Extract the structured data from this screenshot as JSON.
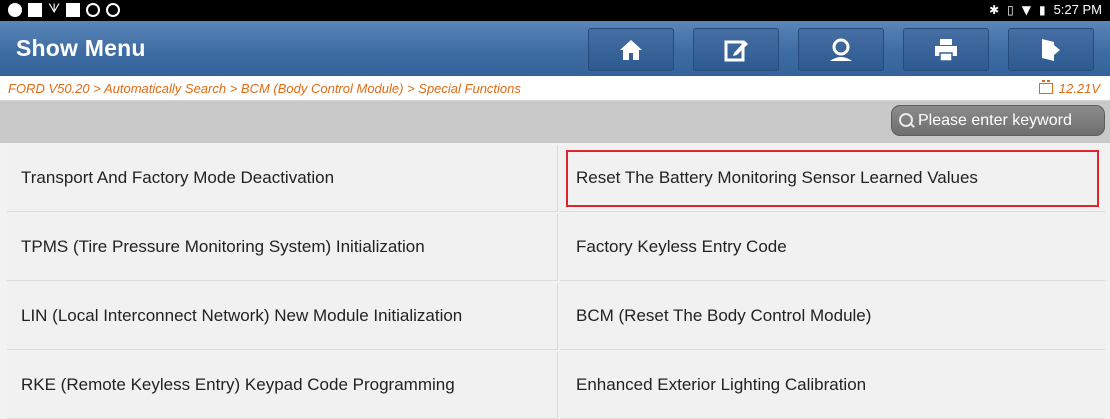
{
  "status_bar": {
    "left_icons": [
      "app-icon",
      "image-icon",
      "usb-icon",
      "square-icon",
      "record-icon",
      "camera-icon"
    ],
    "right_icons": [
      "bluetooth-icon",
      "vibrate-icon",
      "wifi-icon",
      "battery-icon"
    ],
    "time": "5:27 PM"
  },
  "header": {
    "title": "Show Menu",
    "buttons": [
      {
        "name": "home-button",
        "icon": "home-icon"
      },
      {
        "name": "report-button",
        "icon": "edit-icon"
      },
      {
        "name": "feedback-button",
        "icon": "user-icon"
      },
      {
        "name": "print-button",
        "icon": "print-icon"
      },
      {
        "name": "exit-button",
        "icon": "exit-icon"
      }
    ]
  },
  "breadcrumb": {
    "text": "FORD V50.20 > Automatically Search > BCM (Body Control Module) > Special Functions",
    "voltage": "12.21V"
  },
  "search": {
    "placeholder": "Please enter keyword"
  },
  "menu": {
    "items": [
      "Transport And Factory Mode Deactivation",
      "Reset The Battery Monitoring Sensor Learned Values",
      "TPMS (Tire Pressure Monitoring System) Initialization",
      "Factory Keyless Entry Code",
      "LIN (Local Interconnect Network) New Module Initialization",
      "BCM (Reset The Body Control Module)",
      "RKE (Remote Keyless Entry) Keypad Code Programming",
      "Enhanced Exterior Lighting Calibration"
    ],
    "highlighted_index": 1
  },
  "colors": {
    "accent": "#3e6da3",
    "breadcrumb": "#e06a12",
    "highlight": "#e0242b"
  }
}
